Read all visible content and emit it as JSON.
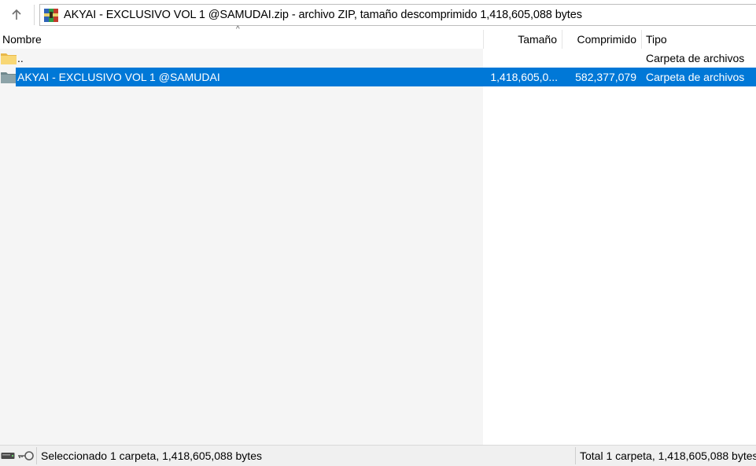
{
  "address_bar": {
    "text": "AKYAI - EXCLUSIVO VOL 1 @SAMUDAI.zip - archivo ZIP, tamaño descomprimido 1,418,605,088 bytes"
  },
  "columns": {
    "name": "Nombre",
    "size": "Tamaño",
    "compressed": "Comprimido",
    "type": "Tipo"
  },
  "rows": [
    {
      "name": "..",
      "size": "",
      "compressed": "",
      "type": "Carpeta de archivos",
      "selected": false
    },
    {
      "name": "AKYAI - EXCLUSIVO VOL 1 @SAMUDAI",
      "size": "1,418,605,0...",
      "compressed": "582,377,079",
      "type": "Carpeta de archivos",
      "selected": true
    }
  ],
  "status": {
    "left": "Seleccionado 1 carpeta, 1,418,605,088 bytes",
    "right": "Total 1 carpeta, 1,418,605,088 bytes"
  },
  "colors": {
    "selection": "#0078d7",
    "folder_yellow": "#f8d775",
    "folder_grey": "#8ca3a8"
  },
  "icons": {
    "up": "arrow-up-icon",
    "archive": "winrar-archive-icon",
    "folder": "folder-icon",
    "drive": "drive-icon",
    "key": "key-icon"
  }
}
